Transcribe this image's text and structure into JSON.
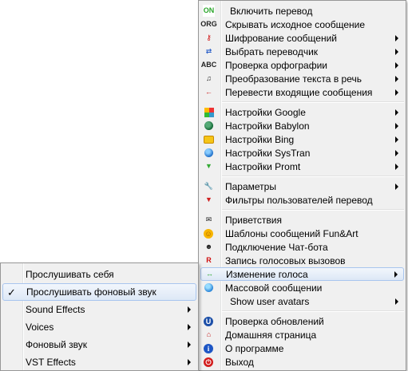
{
  "main_menu": {
    "items": [
      {
        "label": "Включить перевод",
        "icon": "on-icon",
        "glyph": "ON"
      },
      {
        "label": "Скрывать исходное сообщение",
        "icon": "org-icon",
        "glyph": "ORG"
      },
      {
        "label": "Шифрование сообщений",
        "icon": "key-icon",
        "glyph": "⚷"
      },
      {
        "label": "Выбрать переводчик",
        "icon": "swap-arrows-icon",
        "glyph": "⇄"
      },
      {
        "label": "Проверка орфографии",
        "icon": "abc-icon",
        "glyph": "ABC"
      },
      {
        "label": "Преобразование текста в речь",
        "icon": "music-note-icon",
        "glyph": "♫"
      },
      {
        "label": "Перевести входящие сообщения",
        "icon": "arrow-left-icon",
        "glyph": "←"
      },
      {
        "label": "Настройки Google",
        "icon": "google-icon"
      },
      {
        "label": "Настройки Babylon",
        "icon": "babylon-icon"
      },
      {
        "label": "Настройки Bing",
        "icon": "bing-icon"
      },
      {
        "label": "Настройки SysTran",
        "icon": "systran-icon"
      },
      {
        "label": "Настройки Promt",
        "icon": "promt-icon",
        "glyph": "▼"
      },
      {
        "label": "Параметры",
        "icon": "wrench-icon",
        "glyph": "🔧"
      },
      {
        "label": "Фильтры пользователей перевод",
        "icon": "filter-icon",
        "glyph": "▼"
      },
      {
        "label": "Приветствия",
        "icon": "envelope-icon",
        "glyph": "✉"
      },
      {
        "label": "Шаблоны сообщений Fun&Art",
        "icon": "smiley-icon",
        "glyph": "☺"
      },
      {
        "label": "Подключение Чат-бота",
        "icon": "bot-icon",
        "glyph": "☻"
      },
      {
        "label": "Запись голосовых вызовов",
        "icon": "record-icon",
        "glyph": "R"
      },
      {
        "label": "Изменение голоса",
        "icon": "voice-change-icon",
        "glyph": "↔"
      },
      {
        "label": "Массовой сообщении",
        "icon": "mass-message-icon"
      },
      {
        "label": "Show user avatars"
      },
      {
        "label": "Проверка обновлений",
        "icon": "update-icon",
        "glyph": "U"
      },
      {
        "label": "Домашняя страница",
        "icon": "home-icon",
        "glyph": "⌂"
      },
      {
        "label": "О программе",
        "icon": "info-icon",
        "glyph": "i"
      },
      {
        "label": "Выход",
        "icon": "exit-icon",
        "glyph": "⏻"
      }
    ]
  },
  "sub_menu": {
    "items": [
      {
        "label": "Прослушивать себя"
      },
      {
        "label": "Прослушивать фоновый звук",
        "checked": "✓"
      },
      {
        "label": "Sound Effects"
      },
      {
        "label": "Voices"
      },
      {
        "label": "Фоновый звук"
      },
      {
        "label": "VST Effects"
      }
    ]
  },
  "colors": {
    "menu_bg": "#f0f0f0",
    "highlight_border": "#a8c5ee",
    "highlight_bg": "#dde8f6"
  }
}
